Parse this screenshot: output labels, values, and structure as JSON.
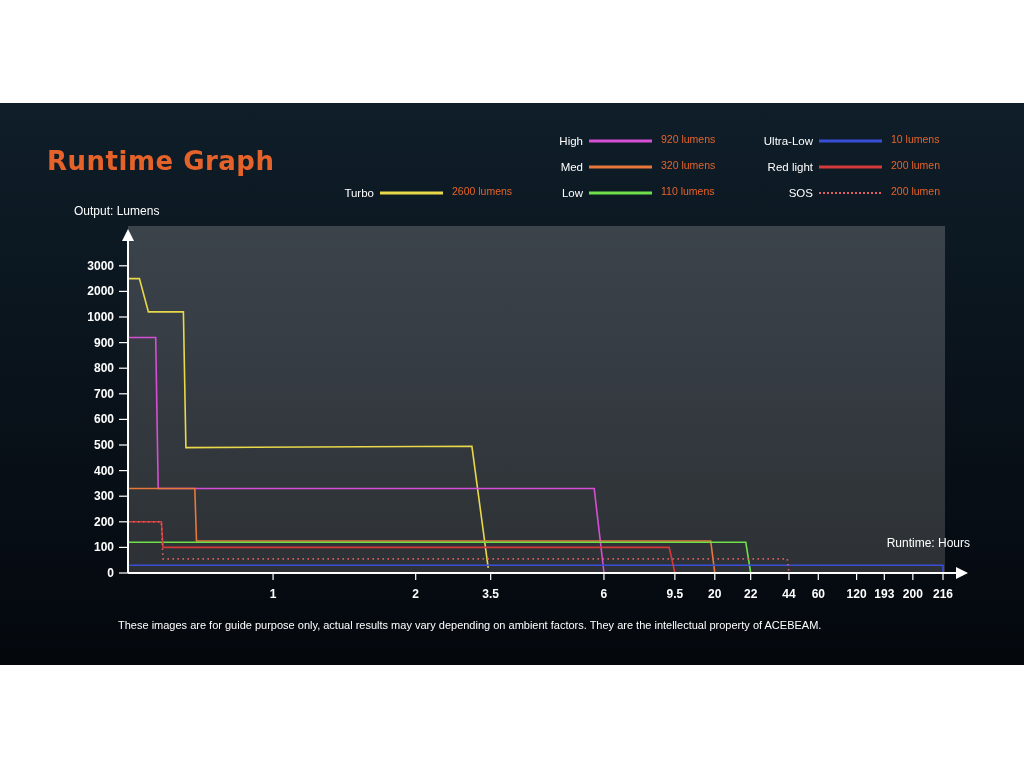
{
  "graph": {
    "title": "Runtime Graph",
    "legend": [
      {
        "name": "Turbo",
        "value": "2600 lumens",
        "color": "#e8d84a",
        "kind": "solid"
      },
      {
        "name": "High",
        "value": "920 lumens",
        "color": "#d64fd6",
        "kind": "solid"
      },
      {
        "name": "Med",
        "value": "320 lumens",
        "color": "#e8783a",
        "kind": "solid"
      },
      {
        "name": "Low",
        "value": "110 lumens",
        "color": "#6fe04a",
        "kind": "solid"
      },
      {
        "name": "Ultra-Low",
        "value": "10 lumens",
        "color": "#3a4fd8",
        "kind": "solid"
      },
      {
        "name": "Red light",
        "value": "200 lumen",
        "color": "#d43a3a",
        "kind": "solid"
      },
      {
        "name": "SOS",
        "value": "200 lumen",
        "color": "#e06060",
        "kind": "dotted"
      }
    ],
    "y_axis_label": "Output: Lumens",
    "x_axis_label": "Runtime: Hours",
    "y_axis_ticks": [
      "3000",
      "2000",
      "1000",
      "900",
      "800",
      "700",
      "600",
      "500",
      "400",
      "300",
      "200",
      "100",
      "0"
    ],
    "x_axis_ticks": [
      "1",
      "2",
      "3.5",
      "6",
      "9.5",
      "20",
      "22",
      "44",
      "60",
      "120",
      "193",
      "200",
      "216"
    ]
  },
  "disclaimer": "These images are for guide purpose only, actual results may vary depending on ambient factors. They are the intellectual property of ACEBEAM."
}
